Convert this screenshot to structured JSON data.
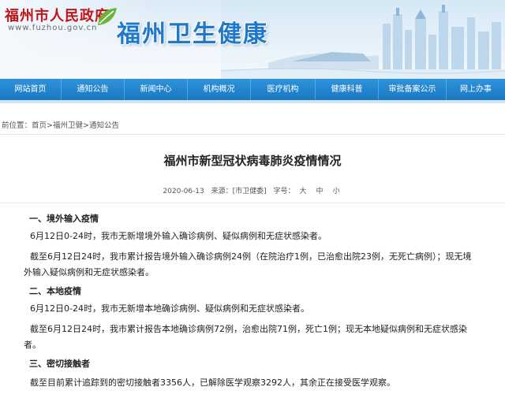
{
  "header": {
    "site_title": "福州市人民政府",
    "site_url": "www.fuzhou.gov.cn",
    "brand": "福州卫生健康"
  },
  "nav": {
    "items": [
      {
        "label": "网站首页"
      },
      {
        "label": "通知公告"
      },
      {
        "label": "新闻中心"
      },
      {
        "label": "机构概况"
      },
      {
        "label": "医疗机构"
      },
      {
        "label": "健康科普"
      },
      {
        "label": "审批备案公示"
      },
      {
        "label": "网上办事"
      }
    ]
  },
  "breadcrumb": {
    "prefix": "前位置：",
    "items": [
      "首页",
      "福州卫健",
      "通知公告"
    ],
    "separator": ">"
  },
  "article": {
    "title": "福州市新型冠状病毒肺炎疫情情况",
    "date": "2020-06-13",
    "source": "来源：[市卫健委]",
    "font_label": "字号：",
    "font_large": "大",
    "font_medium": "中",
    "font_small": "小",
    "sections": [
      {
        "heading": "一、境外输入疫情",
        "p1": "6月12日0-24时，我市无新增境外输入确诊病例、疑似病例和无症状感染者。",
        "p2a": "截至6月12日24时，我市累计报告境外输入确诊病例24例（在院治疗1例，已治愈出院23例，无死亡病例）；现无境",
        "p2b": "外输入疑似病例和无症状感染者。"
      },
      {
        "heading": "二、本地疫情",
        "p1": "6月12日0-24时，我市无新增本地确诊病例、疑似病例和无症状感染者。",
        "p2a": "截至6月12日24时，我市累计报告本地确诊病例72例，治愈出院71例，死亡1例；现无本地疑似病例和无症状感染",
        "p2b": "者。"
      },
      {
        "heading": "三、密切接触者",
        "p1": "截至目前累计追踪到的密切接触者3356人，已解除医学观察3292人，其余正在接受医学观察。"
      }
    ]
  },
  "colors": {
    "nav_blue": "#1f82cc",
    "brand_blue": "#1f78c8",
    "site_red": "#c0141b"
  }
}
